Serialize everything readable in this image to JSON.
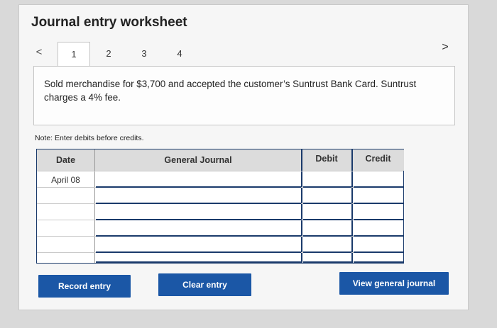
{
  "page": {
    "title": "Journal entry worksheet"
  },
  "nav": {
    "prev": "<",
    "next": ">"
  },
  "tabs": [
    {
      "label": "1",
      "active": true
    },
    {
      "label": "2",
      "active": false
    },
    {
      "label": "3",
      "active": false
    },
    {
      "label": "4",
      "active": false
    }
  ],
  "transaction": {
    "description": "Sold merchandise for $3,700 and accepted the customer’s Suntrust Bank Card. Suntrust charges a 4% fee."
  },
  "note": "Note: Enter debits before credits.",
  "journal": {
    "columns": {
      "date": "Date",
      "general_journal": "General Journal",
      "debit": "Debit",
      "credit": "Credit"
    },
    "rows": [
      {
        "date": "April 08",
        "account": "",
        "debit": "",
        "credit": ""
      },
      {
        "date": "",
        "account": "",
        "debit": "",
        "credit": ""
      },
      {
        "date": "",
        "account": "",
        "debit": "",
        "credit": ""
      },
      {
        "date": "",
        "account": "",
        "debit": "",
        "credit": ""
      },
      {
        "date": "",
        "account": "",
        "debit": "",
        "credit": ""
      },
      {
        "date": "",
        "account": "",
        "debit": "",
        "credit": ""
      }
    ]
  },
  "buttons": {
    "record": "Record entry",
    "clear": "Clear entry",
    "view": "View general journal"
  },
  "colors": {
    "button_bg": "#1b57a6",
    "grid_border": "#1a3a6b",
    "header_bg": "#dcdcdc"
  }
}
